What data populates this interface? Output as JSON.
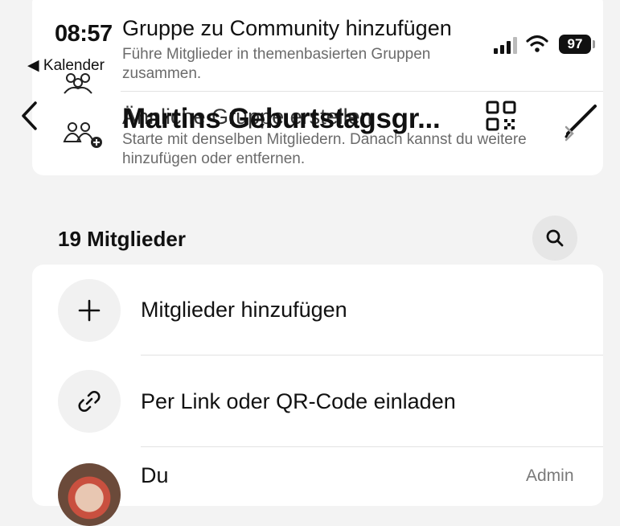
{
  "status_bar": {
    "time": "08:57",
    "back_app": "◀ Kalender",
    "battery": "97"
  },
  "top_options": [
    {
      "title": "Gruppe zu Community hinzufügen",
      "subtitle": "Führe Mitglieder in themenbasierten Gruppen zusammen."
    },
    {
      "title": "Ähnliche Gruppe erstellen",
      "subtitle": "Starte mit denselben Mitgliedern. Danach kannst du weitere hinzufügen oder entfernen."
    }
  ],
  "header": {
    "title": "Martins Geburtstagsgr..."
  },
  "members": {
    "section_title": "19 Mitglieder",
    "add_label": "Mitglieder hinzufügen",
    "invite_label": "Per Link oder QR-Code einladen",
    "self_name": "Du",
    "self_role": "Admin"
  }
}
